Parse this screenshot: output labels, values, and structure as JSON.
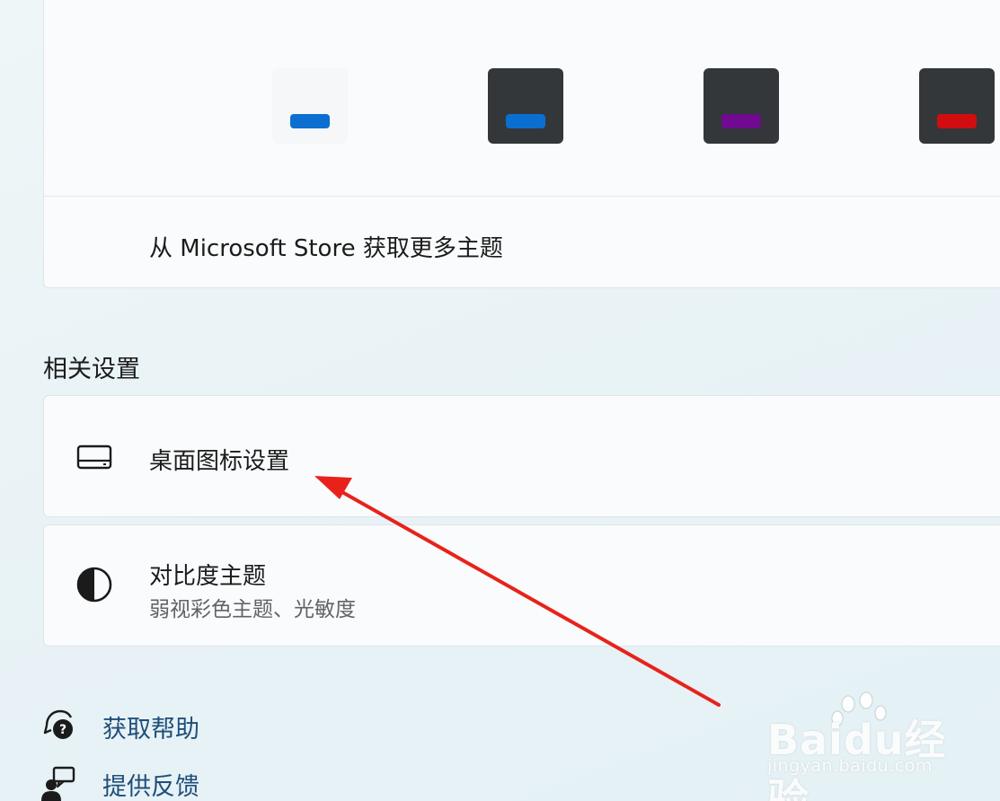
{
  "themes": {
    "tiles": [
      {
        "name": "light-theme",
        "background": "#f7f8f9",
        "accent": "#0a6fd1"
      },
      {
        "name": "dark-blue-theme",
        "background": "#33373a",
        "accent": "#0a6fd1"
      },
      {
        "name": "dark-purple-theme",
        "background": "#33373a",
        "accent": "#6f0a91"
      },
      {
        "name": "dark-red-theme",
        "background": "#33373a",
        "accent": "#d10d12"
      }
    ],
    "store_link": "从 Microsoft Store 获取更多主题"
  },
  "related_settings": {
    "title": "相关设置",
    "desktop_icons": {
      "label": "桌面图标设置",
      "icon": "monitor-icon"
    },
    "contrast": {
      "label": "对比度主题",
      "sublabel": "弱视彩色主题、光敏度",
      "icon": "contrast-icon"
    }
  },
  "help": {
    "get_help": {
      "label": "获取帮助",
      "icon": "help-chat-icon"
    },
    "feedback": {
      "label": "提供反馈",
      "icon": "feedback-icon"
    }
  },
  "annotation": {
    "color": "#e8221b"
  },
  "watermark": {
    "brand": "Baidu经验",
    "url": "jingyan.baidu.com"
  }
}
